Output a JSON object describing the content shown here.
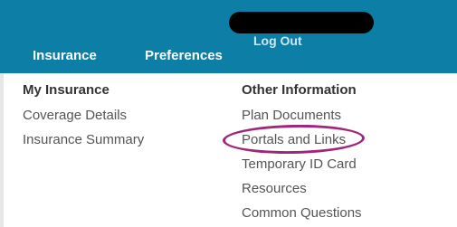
{
  "header": {
    "logout_label": "Log Out",
    "nav": [
      {
        "label": "Insurance"
      },
      {
        "label": "Preferences"
      }
    ]
  },
  "menu": {
    "left": {
      "heading": "My Insurance",
      "items": [
        "Coverage Details",
        "Insurance Summary"
      ]
    },
    "right": {
      "heading": "Other Information",
      "items": [
        "Plan Documents",
        "Portals and Links",
        "Temporary ID Card",
        "Resources",
        "Common Questions"
      ]
    }
  },
  "colors": {
    "header_bg": "#0d7ea5",
    "highlight": "#a1267a"
  }
}
